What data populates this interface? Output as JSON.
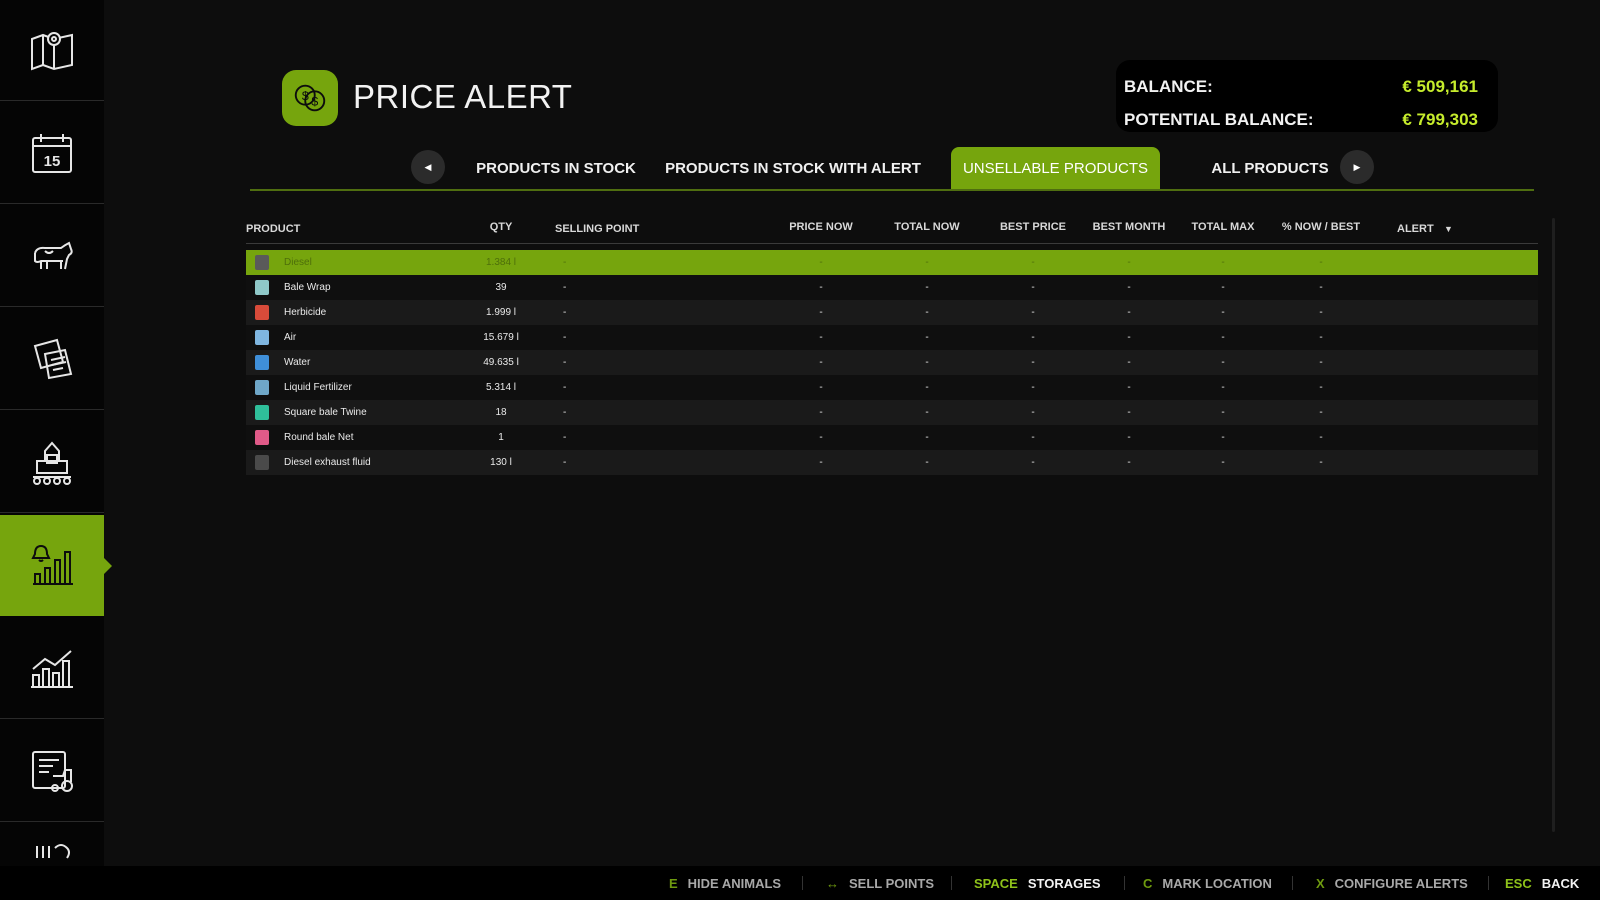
{
  "header": {
    "title": "PRICE ALERT",
    "title_icon": "coins-icon",
    "balance_label": "BALANCE:",
    "balance_value": "€ 509,161",
    "potential_label": "POTENTIAL BALANCE:",
    "potential_value": "€ 799,303"
  },
  "sidebar": {
    "items": [
      {
        "icon": "map-icon"
      },
      {
        "icon": "calendar-icon",
        "text": "15"
      },
      {
        "icon": "animals-icon"
      },
      {
        "icon": "contracts-icon"
      },
      {
        "icon": "production-icon"
      },
      {
        "icon": "price-alert-icon",
        "active": true
      },
      {
        "icon": "statistics-icon"
      },
      {
        "icon": "vehicles-list-icon"
      },
      {
        "icon": "more-icon"
      }
    ]
  },
  "tabs": {
    "prev_icon": "◀",
    "next_icon": "▶",
    "items": [
      {
        "label": "PRODUCTS IN STOCK"
      },
      {
        "label": "PRODUCTS IN STOCK WITH ALERT"
      },
      {
        "label": "UNSELLABLE PRODUCTS",
        "active": true
      },
      {
        "label": "ALL PRODUCTS"
      }
    ]
  },
  "table": {
    "columns": [
      "PRODUCT",
      "QTY",
      "SELLING POINT",
      "PRICE NOW",
      "TOTAL NOW",
      "BEST PRICE",
      "BEST MONTH",
      "TOTAL MAX",
      "% NOW / BEST",
      "ALERT"
    ],
    "sort_icon": "▼",
    "rows": [
      {
        "name": "Diesel",
        "qty": "1.384 l",
        "icon_color": "#5a5a5a",
        "selected": true,
        "cells": [
          "-",
          "-",
          "-",
          "-",
          "-",
          "-",
          "-",
          "-"
        ]
      },
      {
        "name": "Bale Wrap",
        "qty": "39",
        "icon_color": "#8fc8c8",
        "cells": [
          "-",
          "-",
          "-",
          "-",
          "-",
          "-",
          "-",
          "-"
        ]
      },
      {
        "name": "Herbicide",
        "qty": "1.999 l",
        "icon_color": "#d84b3a",
        "cells": [
          "-",
          "-",
          "-",
          "-",
          "-",
          "-",
          "-",
          "-"
        ]
      },
      {
        "name": "Air",
        "qty": "15.679 l",
        "icon_color": "#7fb6e0",
        "cells": [
          "-",
          "-",
          "-",
          "-",
          "-",
          "-",
          "-",
          "-"
        ]
      },
      {
        "name": "Water",
        "qty": "49.635 l",
        "icon_color": "#3f8fd9",
        "cells": [
          "-",
          "-",
          "-",
          "-",
          "-",
          "-",
          "-",
          "-"
        ]
      },
      {
        "name": "Liquid Fertilizer",
        "qty": "5.314 l",
        "icon_color": "#6fa7c8",
        "cells": [
          "-",
          "-",
          "-",
          "-",
          "-",
          "-",
          "-",
          "-"
        ]
      },
      {
        "name": "Square bale Twine",
        "qty": "18",
        "icon_color": "#2fbf9a",
        "cells": [
          "-",
          "-",
          "-",
          "-",
          "-",
          "-",
          "-",
          "-"
        ]
      },
      {
        "name": "Round bale Net",
        "qty": "1",
        "icon_color": "#e05a88",
        "cells": [
          "-",
          "-",
          "-",
          "-",
          "-",
          "-",
          "-",
          "-"
        ]
      },
      {
        "name": "Diesel exhaust fluid",
        "qty": "130 l",
        "icon_color": "#4a4a4a",
        "cells": [
          "-",
          "-",
          "-",
          "-",
          "-",
          "-",
          "-",
          "-"
        ]
      }
    ]
  },
  "footer": {
    "hints": [
      {
        "key": "E",
        "label": "HIDE ANIMALS"
      },
      {
        "key": "↔",
        "label": "SELL POINTS"
      },
      {
        "key": "SPACE",
        "label": "STORAGES",
        "highlight": true
      },
      {
        "key": "C",
        "label": "MARK LOCATION"
      },
      {
        "key": "X",
        "label": "CONFIGURE ALERTS"
      },
      {
        "key": "ESC",
        "label": "BACK",
        "highlight": true
      }
    ]
  },
  "colors": {
    "accent": "#76a50d",
    "balance_value": "#c6ec2c",
    "background": "#0d0d0d"
  }
}
